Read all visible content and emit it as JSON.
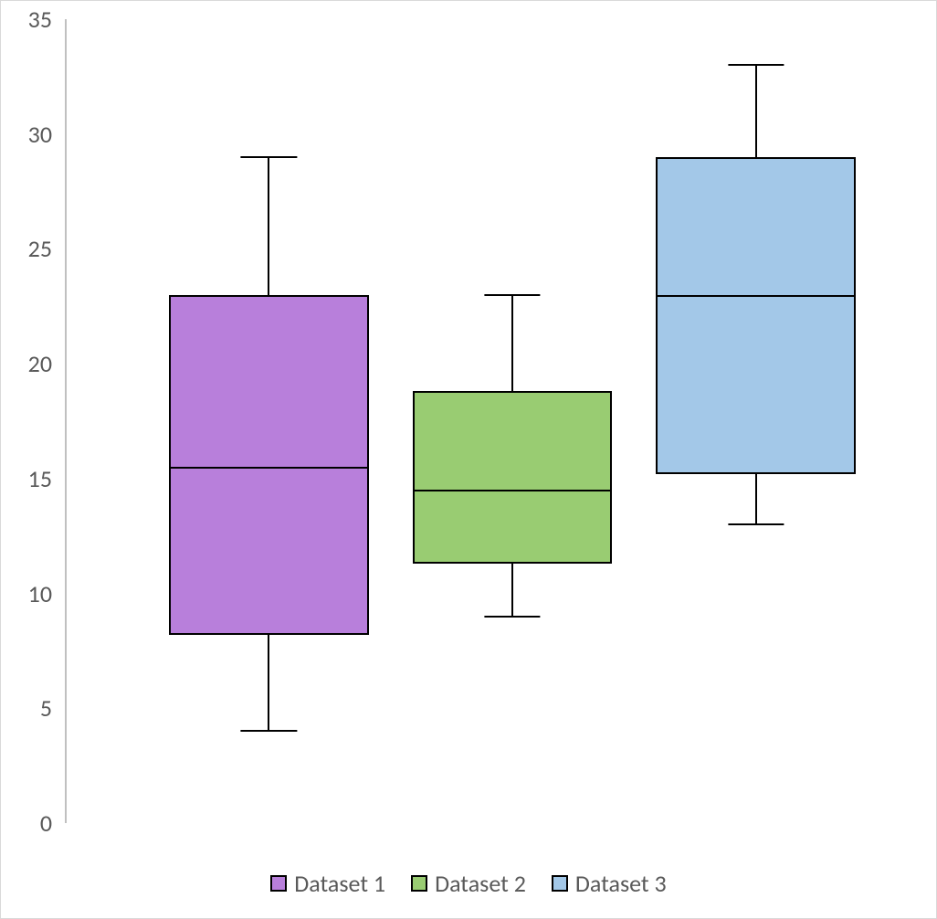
{
  "chart_data": {
    "type": "boxplot",
    "ylabel": "",
    "xlabel": "",
    "title": "",
    "ylim": [
      0,
      35
    ],
    "y_ticks": [
      0,
      5,
      10,
      15,
      20,
      25,
      30,
      35
    ],
    "series": [
      {
        "name": "Dataset 1",
        "color": "#b87fdb",
        "min": 4,
        "q1": 8.2,
        "median": 15.5,
        "q3": 23,
        "max": 29
      },
      {
        "name": "Dataset 2",
        "color": "#99cc72",
        "min": 9,
        "q1": 11.3,
        "median": 14.5,
        "q3": 18.8,
        "max": 23
      },
      {
        "name": "Dataset 3",
        "color": "#a3c8e8",
        "min": 13,
        "q1": 15.2,
        "median": 23,
        "q3": 29,
        "max": 33
      }
    ],
    "legend_position": "bottom",
    "grid": false
  },
  "legend": {
    "items": [
      {
        "label": "Dataset 1"
      },
      {
        "label": "Dataset 2"
      },
      {
        "label": "Dataset 3"
      }
    ]
  },
  "y_tick_labels": [
    "0",
    "5",
    "10",
    "15",
    "20",
    "25",
    "30",
    "35"
  ]
}
